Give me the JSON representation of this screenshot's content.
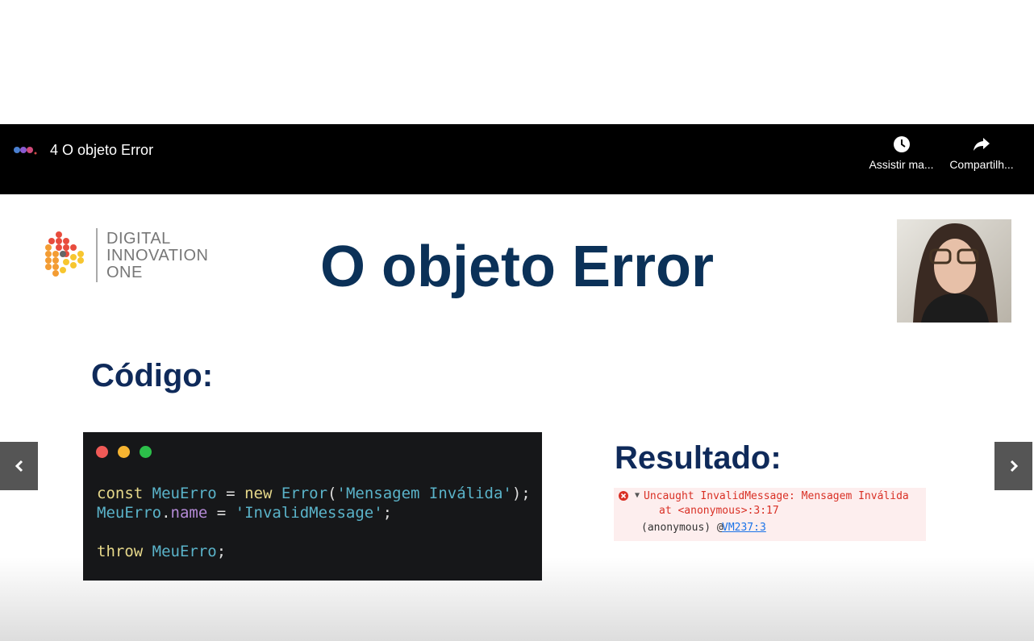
{
  "player": {
    "title": "4 O objeto Error",
    "actions": [
      {
        "label": "Assistir ma...",
        "icon": "clock-icon"
      },
      {
        "label": "Compartilh...",
        "icon": "share-icon"
      }
    ]
  },
  "slide": {
    "logo_text": [
      "DIGITAL",
      "INNOVATION",
      "ONE"
    ],
    "title": "O objeto Error",
    "code_heading": "Código:",
    "result_heading": "Resultado:",
    "code": {
      "line1": {
        "kw": "const",
        "var": "MeuErro",
        "op": " = ",
        "kw2": "new",
        "cls": "Error",
        "p1": "(",
        "str": "'Mensagem Inválida'",
        "p2": ");"
      },
      "line2": {
        "var": "MeuErro",
        "dot": ".",
        "prop": "name",
        "op": " = ",
        "str": "'InvalidMessage'",
        "semi": ";"
      },
      "line3": {
        "kw": "throw",
        "var": "MeuErro",
        "semi": ";"
      }
    },
    "console": {
      "message": "Uncaught InvalidMessage: Mensagem Inválida",
      "stack": "at <anonymous>:3:17",
      "source_prefix": "(anonymous) @",
      "source_link": "VM237:3"
    }
  },
  "colors": {
    "title": "#0b3158",
    "error": "#d93025",
    "link": "#1a73e8"
  }
}
